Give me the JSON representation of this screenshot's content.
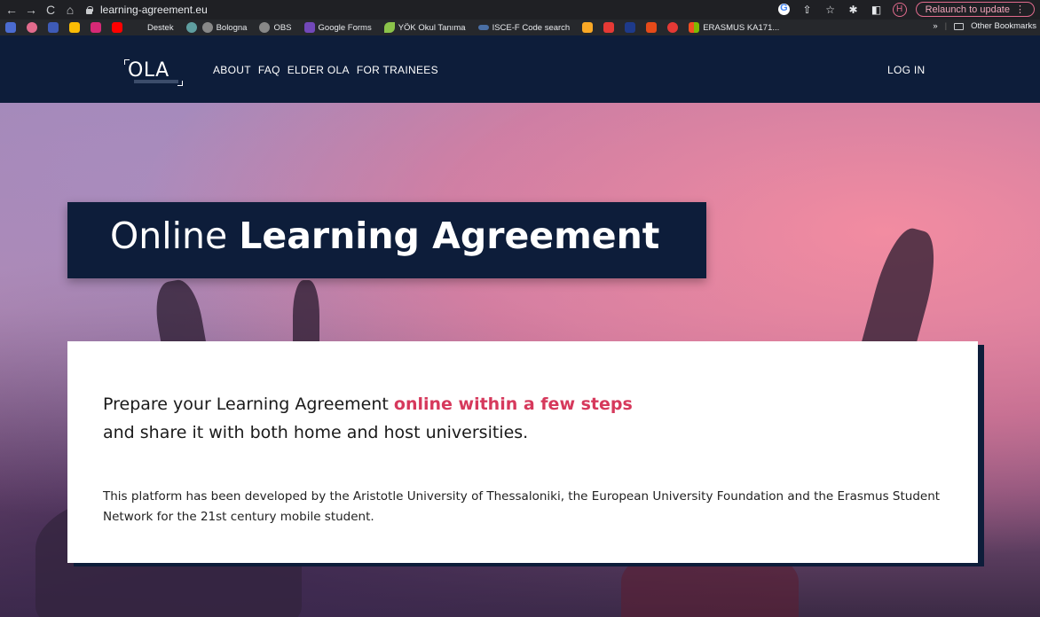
{
  "browser": {
    "url": "learning-agreement.eu",
    "relaunch_label": "Relaunch to update",
    "avatar_letter": "H"
  },
  "bookmarks": {
    "items": [
      {
        "label": "Destek",
        "color": "#1a73e8"
      },
      {
        "label": "Bologna",
        "color": "#5f6368"
      },
      {
        "label": "OBS",
        "color": "#5f6368"
      },
      {
        "label": "Google Forms",
        "color": "#7248b9"
      },
      {
        "label": "YÖK Okul Tanıma",
        "color": "#8bc34a"
      },
      {
        "label": "ISCE-F Code search",
        "color": "#4a6fa5"
      },
      {
        "label": "ERASMUS KA171...",
        "color": "#f25022"
      }
    ],
    "more": "»",
    "other": "Other Bookmarks"
  },
  "site": {
    "logo": "OLA",
    "nav": [
      "ABOUT",
      "FAQ",
      "ELDER OLA",
      "FOR TRAINEES"
    ],
    "login": "LOG IN"
  },
  "hero": {
    "title_light": "Online",
    "title_bold": "Learning Agreement"
  },
  "card": {
    "lead_1": "Prepare your Learning Agreement",
    "lead_accent": "online within a few steps",
    "lead_2": "and share it with both home and host universities.",
    "desc": "This platform has been developed by the Aristotle University of Thessaloniki, the European University Foundation and the Erasmus Student Network for the 21st century mobile student."
  },
  "colors": {
    "navy": "#0d1d3a",
    "accent": "#d6395c"
  }
}
